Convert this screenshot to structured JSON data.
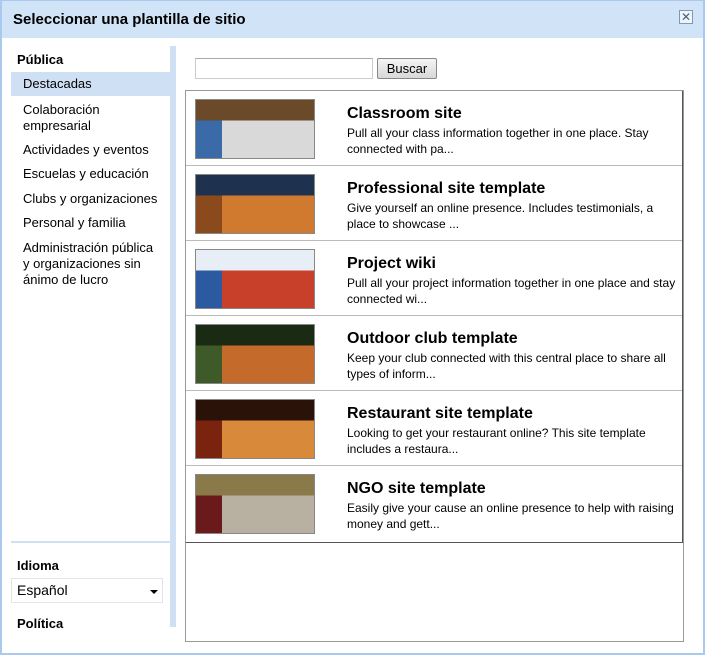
{
  "dialog": {
    "title": "Seleccionar una plantilla de sitio",
    "close_icon": "close-icon"
  },
  "sidebar": {
    "section_public": "Pública",
    "items": [
      {
        "label": "Destacadas",
        "selected": true
      },
      {
        "label": "Colaboración empresarial"
      },
      {
        "label": "Actividades y eventos"
      },
      {
        "label": "Escuelas y educación"
      },
      {
        "label": "Clubs y organizaciones"
      },
      {
        "label": "Personal y familia"
      },
      {
        "label": "Administración pública y organizaciones sin ánimo de lucro"
      }
    ],
    "language_label": "Idioma",
    "language_value": "Español",
    "policy_label": "Política"
  },
  "search": {
    "value": "",
    "placeholder": "",
    "button": "Buscar"
  },
  "templates": [
    {
      "title": "Classroom site",
      "desc": "Pull all your class information together in one place. Stay connected with pa...",
      "colors": [
        "#6b4a2a",
        "#3a6aa8",
        "#d9d9d9"
      ]
    },
    {
      "title": "Professional site template",
      "desc": "Give yourself an online presence. Includes testimonials, a place to showcase ...",
      "colors": [
        "#1e3250",
        "#8a4a1c",
        "#d07a30"
      ]
    },
    {
      "title": "Project wiki",
      "desc": "Pull all your project information together in one place and stay connected wi...",
      "colors": [
        "#e8eef6",
        "#2b5aa0",
        "#c8402a"
      ]
    },
    {
      "title": "Outdoor club template",
      "desc": "Keep your club connected with this central place to share all types of inform...",
      "colors": [
        "#1b2a12",
        "#3d5a28",
        "#c46a2a"
      ]
    },
    {
      "title": "Restaurant site template",
      "desc": "Looking to get your restaurant online? This site template includes a restaura...",
      "colors": [
        "#2a1208",
        "#7a2410",
        "#d88a3a"
      ]
    },
    {
      "title": "NGO site template",
      "desc": "Easily give your cause an online presence to help with raising money and gett...",
      "colors": [
        "#8a7a4a",
        "#6a1a1a",
        "#b8b0a0"
      ]
    }
  ]
}
